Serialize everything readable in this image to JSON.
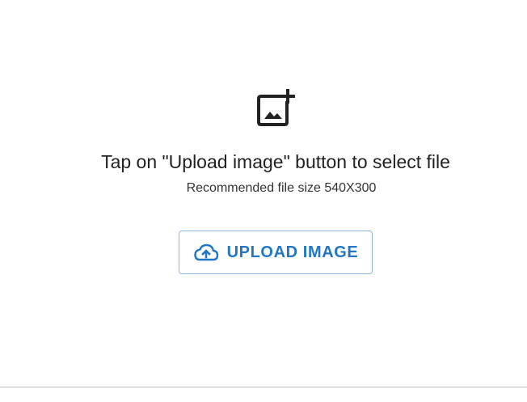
{
  "upload": {
    "icon": "add-photo-icon",
    "instruction": "Tap on \"Upload image\" button to select file",
    "hint": "Recommended file size 540X300",
    "button": {
      "icon": "cloud-upload-icon",
      "label": "UPLOAD IMAGE"
    }
  },
  "colors": {
    "accent": "#2277c4",
    "button_border": "#90b7d8",
    "icon": "#222222",
    "text": "#222222"
  }
}
